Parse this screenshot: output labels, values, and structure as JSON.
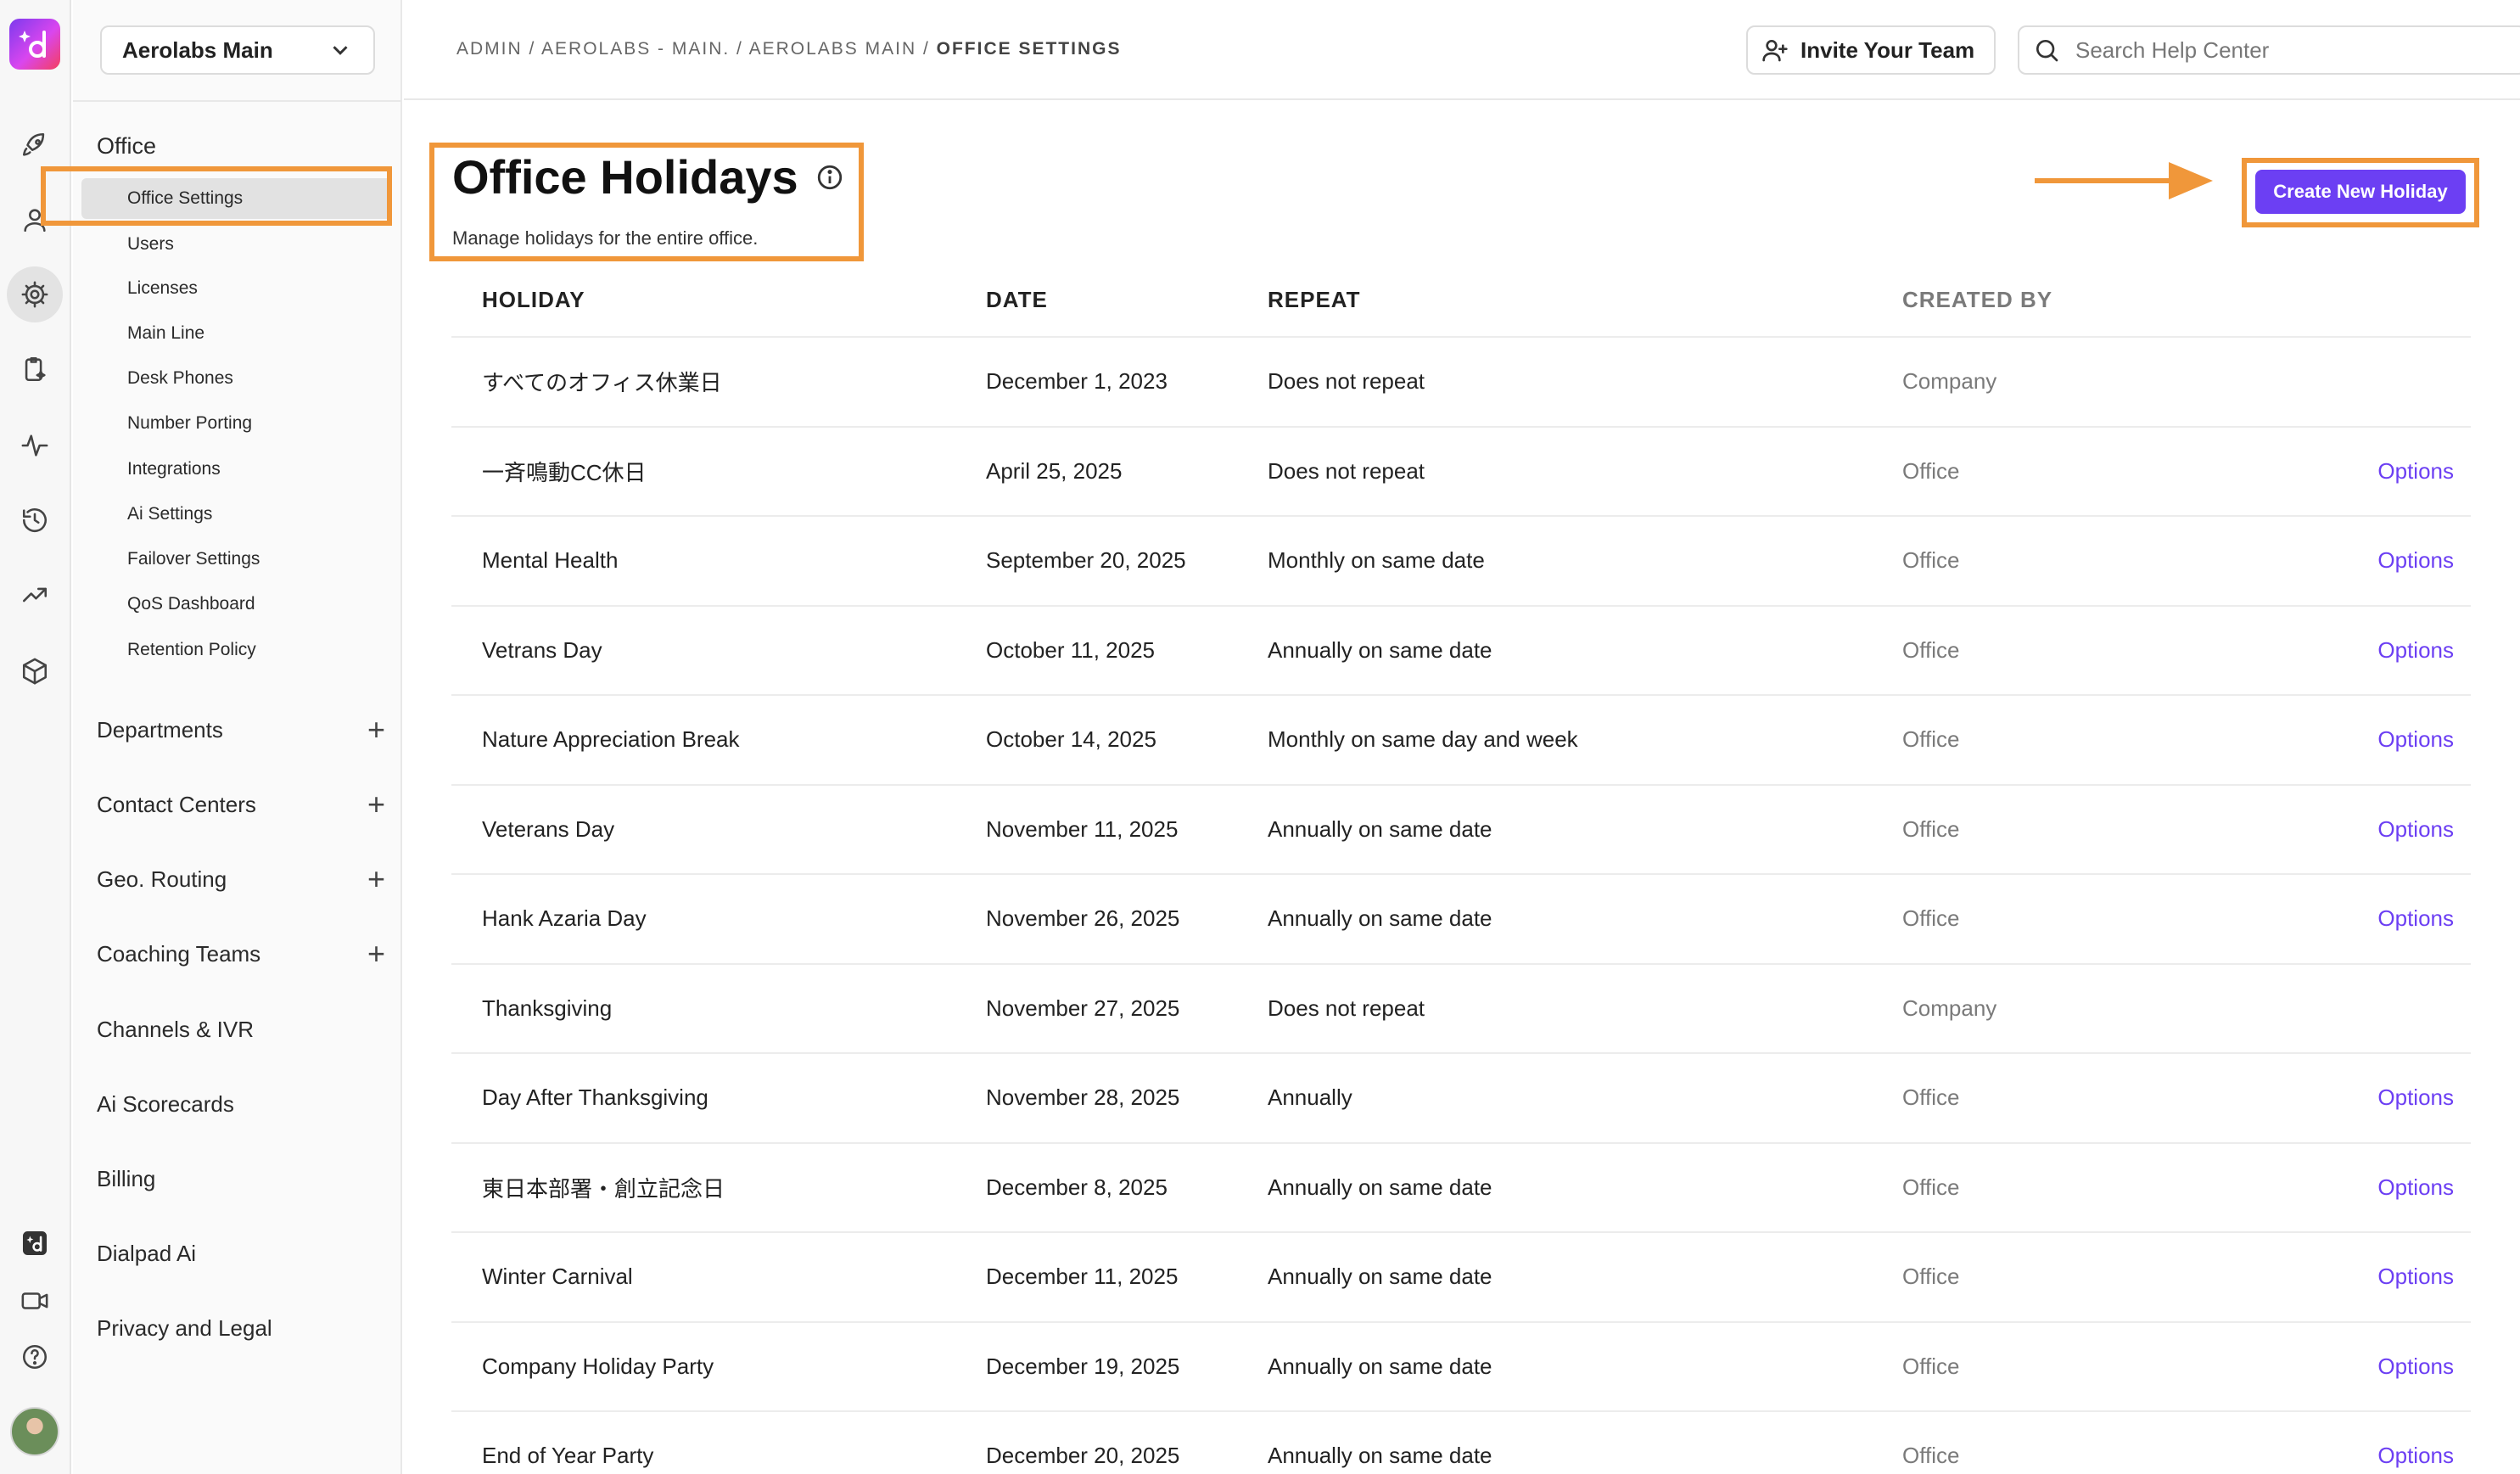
{
  "colors": {
    "accent": "#6c3ff3",
    "highlight": "#f0973a"
  },
  "rail": {
    "icons": [
      "rocket-icon",
      "person-icon",
      "gear-icon",
      "clipboard-sparkle-icon",
      "activity-icon",
      "history-icon",
      "trending-icon",
      "box-icon",
      "dialpad-ai-icon",
      "video-icon",
      "help-icon"
    ]
  },
  "nav": {
    "office_select": "Aerolabs Main",
    "section_title": "Office",
    "sub_items": [
      "Office Settings",
      "Users",
      "Licenses",
      "Main Line",
      "Desk Phones",
      "Number Porting",
      "Integrations",
      "Ai Settings",
      "Failover Settings",
      "QoS Dashboard",
      "Retention Policy"
    ],
    "groups": [
      "Departments",
      "Contact Centers",
      "Geo. Routing",
      "Coaching Teams"
    ],
    "links": [
      "Channels & IVR",
      "Ai Scorecards",
      "Billing",
      "Dialpad Ai",
      "Privacy and Legal"
    ]
  },
  "topbar": {
    "breadcrumb": "ADMIN / AEROLABS - MAIN. / AEROLABS MAIN / ",
    "breadcrumb_current": "OFFICE SETTINGS",
    "invite_label": "Invite Your Team",
    "search_placeholder": "Search Help Center"
  },
  "page": {
    "title": "Office Holidays",
    "subtitle": "Manage holidays for the entire office.",
    "create_label": "Create New Holiday"
  },
  "table": {
    "headers": [
      "HOLIDAY",
      "DATE",
      "REPEAT",
      "CREATED BY"
    ],
    "rows": [
      {
        "holiday": "すべてのオフィス休業日",
        "date": "December 1, 2023",
        "repeat": "Does not repeat",
        "created_by": "Company",
        "options": ""
      },
      {
        "holiday": "一斉鳴動CC休日",
        "date": "April 25, 2025",
        "repeat": "Does not repeat",
        "created_by": "Office",
        "options": "Options"
      },
      {
        "holiday": "Mental Health",
        "date": "September 20, 2025",
        "repeat": "Monthly on same date",
        "created_by": "Office",
        "options": "Options"
      },
      {
        "holiday": "Vetrans Day",
        "date": "October 11, 2025",
        "repeat": "Annually on same date",
        "created_by": "Office",
        "options": "Options"
      },
      {
        "holiday": "Nature Appreciation Break",
        "date": "October 14, 2025",
        "repeat": "Monthly on same day and week",
        "created_by": "Office",
        "options": "Options"
      },
      {
        "holiday": "Veterans Day",
        "date": "November 11, 2025",
        "repeat": "Annually on same date",
        "created_by": "Office",
        "options": "Options"
      },
      {
        "holiday": "Hank Azaria Day",
        "date": "November 26, 2025",
        "repeat": "Annually on same date",
        "created_by": "Office",
        "options": "Options"
      },
      {
        "holiday": "Thanksgiving",
        "date": "November 27, 2025",
        "repeat": "Does not repeat",
        "created_by": "Company",
        "options": ""
      },
      {
        "holiday": "Day After Thanksgiving",
        "date": "November 28, 2025",
        "repeat": "Annually",
        "created_by": "Office",
        "options": "Options"
      },
      {
        "holiday": "東日本部署・創立記念日",
        "date": "December 8, 2025",
        "repeat": "Annually on same date",
        "created_by": "Office",
        "options": "Options"
      },
      {
        "holiday": "Winter Carnival",
        "date": "December 11, 2025",
        "repeat": "Annually on same date",
        "created_by": "Office",
        "options": "Options"
      },
      {
        "holiday": "Company Holiday Party",
        "date": "December 19, 2025",
        "repeat": "Annually on same date",
        "created_by": "Office",
        "options": "Options"
      },
      {
        "holiday": "End of Year Party",
        "date": "December 20, 2025",
        "repeat": "Annually on same date",
        "created_by": "Office",
        "options": "Options"
      }
    ]
  }
}
